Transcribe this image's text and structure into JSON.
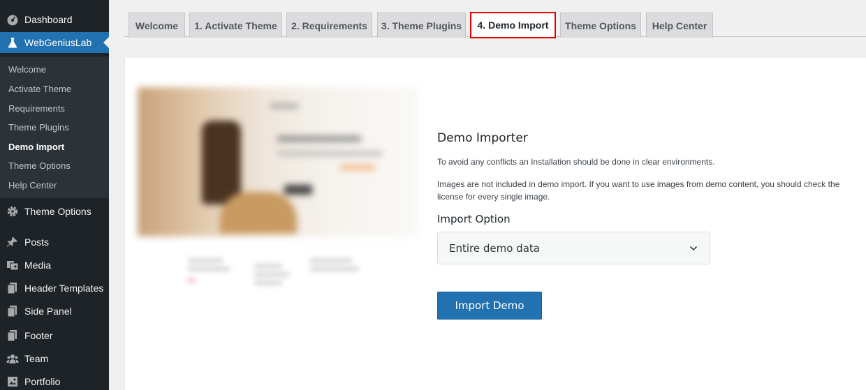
{
  "sidebar": {
    "dashboard": "Dashboard",
    "webgeniuslab": "WebGeniusLab",
    "submenu": [
      "Welcome",
      "Activate Theme",
      "Requirements",
      "Theme Plugins",
      "Demo Import",
      "Theme Options",
      "Help Center"
    ],
    "current_submenu": "Demo Import",
    "theme_options": "Theme Options",
    "posts": "Posts",
    "media": "Media",
    "header_templates": "Header Templates",
    "side_panel": "Side Panel",
    "footer": "Footer",
    "team": "Team",
    "portfolio": "Portfolio"
  },
  "tabs": [
    "Welcome",
    "1. Activate Theme",
    "2. Requirements",
    "3. Theme Plugins",
    "4. Demo Import",
    "Theme Options",
    "Help Center"
  ],
  "active_tab": "4. Demo Import",
  "demo": {
    "heading": "Demo Importer",
    "note1": "To avoid any conflicts an Installation should be done in clear environments.",
    "note2": "Images are not included in demo import. If you want to use images from demo content, you should check the license for every single image.",
    "import_option_label": "Import Option",
    "import_option_value": "Entire demo data",
    "import_button": "Import Demo"
  },
  "colors": {
    "sidebar_bg": "#1d2327",
    "submenu_bg": "#2c3338",
    "accent": "#2271b1",
    "highlight_border": "#e00000"
  },
  "icons": {
    "dashboard": "dashboard-gauge-icon",
    "webgeniuslab": "flask-icon",
    "theme_options": "gear-icon",
    "posts": "pushpin-icon",
    "media": "media-icon",
    "header_templates": "pages-icon",
    "side_panel": "pages-icon",
    "footer": "pages-icon",
    "team": "groups-icon",
    "portfolio": "portfolio-icon",
    "select": "chevron-down-icon"
  }
}
